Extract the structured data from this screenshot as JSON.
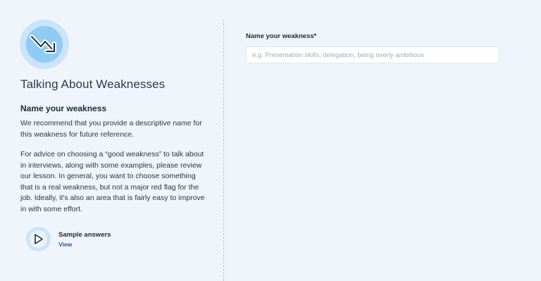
{
  "intro": {
    "icon": "trending-down-icon",
    "title": "Talking About Weaknesses",
    "subtitle": "Name your weakness",
    "paragraph_1": "We recommend that you provide a descriptive name for this weakness for future reference.",
    "paragraph_2": "For advice on choosing a “good weakness” to talk about in interviews, along with some examples, please review our lesson. In general, you want to choose something that is a real weakness, but not a major red flag for the job. Ideally, it's also an area that is fairly easy to improve in with some effort."
  },
  "sample_answers": {
    "icon": "play-icon",
    "label": "Sample answers",
    "link": "View"
  },
  "form": {
    "label": "Name your weakness*",
    "value": "",
    "placeholder": "e.g. Presentation skills, delegation, being overly ambitious"
  },
  "colors": {
    "background": "#f0f5fc",
    "icon_outer": "#c9e4fb",
    "icon_inner": "#8fccf5",
    "link": "#1f5c9e"
  }
}
